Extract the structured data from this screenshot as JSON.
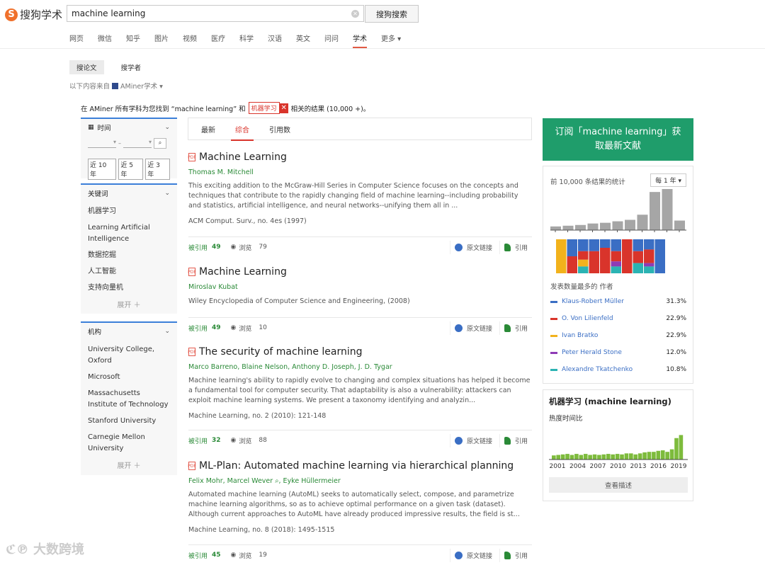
{
  "header": {
    "logo_glyph": "S",
    "logo_text": "搜狗学术",
    "search_value": "machine learning",
    "search_button": "搜狗搜索",
    "nav": [
      {
        "label": "网页",
        "active": false
      },
      {
        "label": "微信",
        "active": false
      },
      {
        "label": "知乎",
        "active": false
      },
      {
        "label": "图片",
        "active": false
      },
      {
        "label": "视频",
        "active": false
      },
      {
        "label": "医疗",
        "active": false
      },
      {
        "label": "科学",
        "active": false
      },
      {
        "label": "汉语",
        "active": false
      },
      {
        "label": "英文",
        "active": false
      },
      {
        "label": "问问",
        "active": false
      },
      {
        "label": "学术",
        "active": true
      },
      {
        "label": "更多 ▾",
        "active": false
      }
    ]
  },
  "subtabs": [
    {
      "label": "搜论文",
      "active": true
    },
    {
      "label": "搜学者",
      "active": false
    }
  ],
  "source_prefix": "以下内容来自",
  "source_name": "AMiner学术 ▾",
  "result_line": {
    "prefix": "在 AMiner 所有学科为您找到 “machine learning” 和",
    "tag": "机器学习",
    "suffix": "相关的结果 (10,000 +)。"
  },
  "filters": {
    "time": {
      "title": "时间",
      "date_sep": "–",
      "years": [
        "近 10 年",
        "近 5 年",
        "近 3 年"
      ]
    },
    "keywords": {
      "title": "关键词",
      "items": [
        "机器学习",
        "Learning Artificial Intelligence",
        "数据挖掘",
        "人工智能",
        "支持向量机"
      ],
      "expand": "展开 ＋"
    },
    "orgs": {
      "title": "机构",
      "items": [
        "University College, Oxford",
        "Microsoft",
        "Massachusetts Institute of Technology",
        "Stanford University",
        "Carnegie Mellon University"
      ],
      "expand": "展开 ＋"
    }
  },
  "sort_tabs": [
    {
      "label": "最新",
      "active": false
    },
    {
      "label": "综合",
      "active": true
    },
    {
      "label": "引用数",
      "active": false
    }
  ],
  "papers": [
    {
      "title": "Machine Learning",
      "authors": "Thomas M. Mitchell",
      "abstract": "This exciting addition to the McGraw-Hill Series in Computer Science focuses on the concepts and techniques that contribute to the rapidly changing field of machine learning--including probability and statistics, artificial intelligence, and neural networks--unifying them all in ...",
      "venue": "ACM Comput. Surv., no. 4es (1997)",
      "cited_label": "被引用",
      "cited": "49",
      "view_label": "浏览",
      "views": "79",
      "link_label": "原文链接",
      "quote_label": "引用"
    },
    {
      "title": "Machine Learning",
      "authors": "Miroslav Kubat",
      "abstract": "",
      "venue": "Wiley Encyclopedia of Computer Science and Engineering, (2008)",
      "cited_label": "被引用",
      "cited": "49",
      "view_label": "浏览",
      "views": "10",
      "link_label": "原文链接",
      "quote_label": "引用"
    },
    {
      "title": "The security of machine learning",
      "authors": "Marco Barreno, Blaine Nelson, Anthony D. Joseph, J. D. Tygar",
      "abstract": "Machine learning's ability to rapidly evolve to changing and complex situations has helped it become a fundamental tool for computer security. That adaptability is also a vulnerability: attackers can exploit machine learning systems. We present a taxonomy identifying and analyzin...",
      "venue": "Machine Learning, no. 2 (2010): 121-148",
      "cited_label": "被引用",
      "cited": "32",
      "view_label": "浏览",
      "views": "88",
      "link_label": "原文链接",
      "quote_label": "引用"
    },
    {
      "title": "ML-Plan: Automated machine learning via hierarchical planning",
      "authors": "Felix Mohr, Marcel Wever ⌕, Eyke Hüllermeier",
      "abstract": "Automated machine learning (AutoML) seeks to automatically select, compose, and parametrize machine learning algorithms, so as to achieve optimal performance on a given task (dataset). Although current approaches to AutoML have already produced impressive results, the field is st...",
      "venue": "Machine Learning, no. 8 (2018): 1495-1515",
      "cited_label": "被引用",
      "cited": "45",
      "view_label": "浏览",
      "views": "19",
      "link_label": "原文链接",
      "quote_label": "引用"
    }
  ],
  "subscribe_text": "订阅「machine learning」获取最新文献",
  "stats": {
    "title": "前 10,000 条结果的统计",
    "year_select": "每 1 年 ▾",
    "authors_title": "发表数量最多的 作者",
    "authors": [
      {
        "name": "Klaus-Robert Müller",
        "pct": "31.3%",
        "color": "#3a6ec4"
      },
      {
        "name": "O. Von Lilienfeld",
        "pct": "22.9%",
        "color": "#d9342b"
      },
      {
        "name": "Ivan Bratko",
        "pct": "22.9%",
        "color": "#f2b21c"
      },
      {
        "name": "Peter Herald Stone",
        "pct": "12.0%",
        "color": "#8e3bb5"
      },
      {
        "name": "Alexandre Tkatchenko",
        "pct": "10.8%",
        "color": "#2bb3b3"
      }
    ]
  },
  "heat": {
    "title": "机器学习  (machine learning)",
    "subtitle": "热度时间比",
    "year_labels": [
      "2001",
      "2004",
      "2007",
      "2010",
      "2013",
      "2016",
      "2019"
    ],
    "button": "查看描述"
  },
  "chart_data": [
    {
      "type": "bar",
      "name_key": "publication-count-histogram",
      "values": [
        5,
        6,
        7,
        9,
        10,
        12,
        14,
        21,
        52,
        56,
        13
      ],
      "color": "#a6a6a6"
    },
    {
      "type": "bar",
      "stacked": true,
      "colors": [
        "#3a6ec4",
        "#d9342b",
        "#f2b21c",
        "#8e3bb5",
        "#2bb3b3"
      ],
      "columns": [
        [
          0,
          0,
          100,
          0,
          0
        ],
        [
          50,
          50,
          0,
          0,
          0
        ],
        [
          35,
          25,
          20,
          0,
          20
        ],
        [
          35,
          65,
          0,
          0,
          0
        ],
        [
          25,
          75,
          0,
          0,
          0
        ],
        [
          35,
          30,
          0,
          15,
          20
        ],
        [
          0,
          100,
          0,
          0,
          0
        ],
        [
          35,
          35,
          0,
          0,
          30
        ],
        [
          30,
          40,
          0,
          10,
          20
        ],
        [
          100,
          0,
          0,
          0,
          0
        ]
      ]
    },
    {
      "type": "bar",
      "name_key": "heat-time-chart",
      "values": [
        8,
        9,
        10,
        11,
        9,
        11,
        9,
        11,
        9,
        10,
        9,
        10,
        11,
        10,
        11,
        10,
        12,
        12,
        10,
        12,
        14,
        15,
        15,
        17,
        18,
        15,
        20,
        42,
        48
      ],
      "color": "#7dbb3c",
      "ylim": [
        0,
        50
      ]
    }
  ]
}
